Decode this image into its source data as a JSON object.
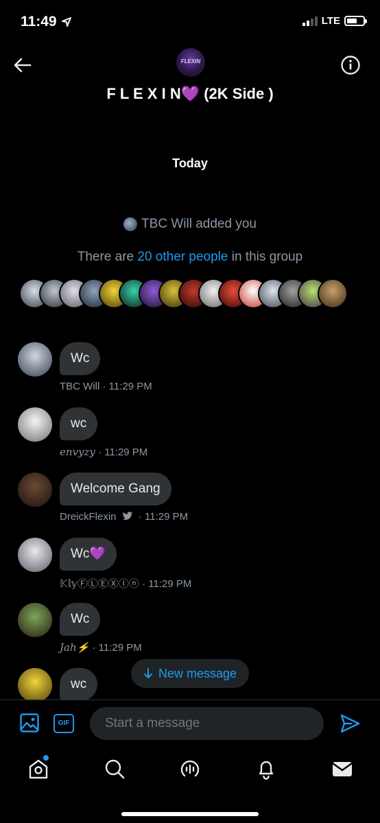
{
  "status": {
    "time": "11:49",
    "network": "LTE",
    "signal_bars_active": 2,
    "battery_level": 0.6
  },
  "header": {
    "title": "F L E X I N💜 (2K Side )",
    "group_avatar_label": "FLEXIN"
  },
  "conversation": {
    "date_divider": "Today",
    "added_text": "TBC Will added you",
    "others_prefix": "There are ",
    "others_link": "20 other people",
    "others_suffix": " in this group",
    "messages": [
      {
        "text": "Wc",
        "sender": "TBC Will",
        "time": "· 11:29 PM"
      },
      {
        "text": "wc",
        "sender": "envyzy",
        "time": "· 11:29 PM"
      },
      {
        "text": "Welcome Gang",
        "sender": "DreickFlexin",
        "time": "· 11:29 PM"
      },
      {
        "text": "Wc💜",
        "sender": "𝕂𝕝𝕪ⒻⓁⒺⓍⒾⓝ",
        "time": "· 11:29 PM"
      },
      {
        "text": "Wc",
        "sender": "Jah⚡",
        "time": "· 11:29 PM"
      },
      {
        "text": "wc"
      }
    ]
  },
  "new_message_pill": {
    "label": "New message"
  },
  "composer": {
    "placeholder": "Start a message",
    "gif_label": "GIF"
  },
  "colors": {
    "accent": "#1d9bf0",
    "bubble": "#2f3336",
    "muted": "#8b98a5",
    "background": "#000000"
  }
}
